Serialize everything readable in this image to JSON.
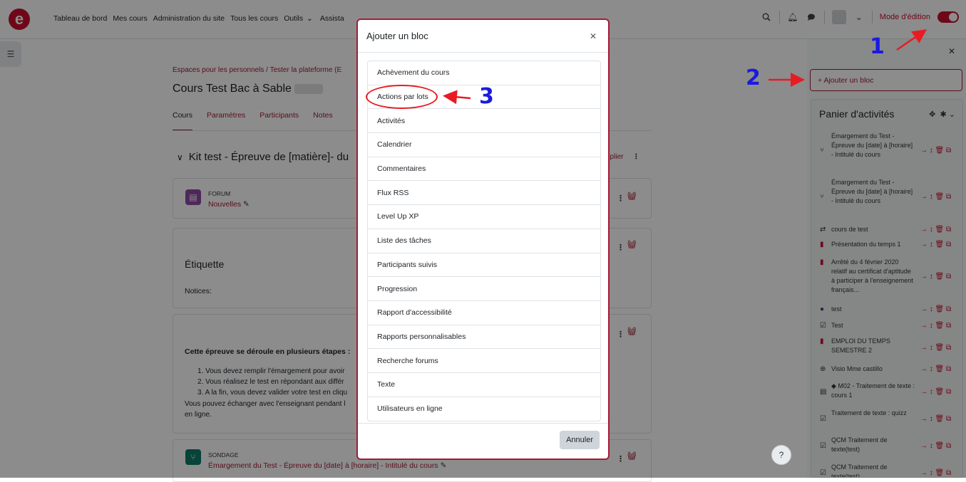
{
  "nav": {
    "logo": "e",
    "links": [
      "Tableau de bord",
      "Mes cours",
      "Administration du site",
      "Tous les cours",
      "Outils",
      "Assista"
    ],
    "mode_edition": "Mode d'édition"
  },
  "page": {
    "breadcrumb": "Espaces pour les personnels  /  Tester la plateforme (E",
    "title": "Cours Test Bac à Sable",
    "tabs": [
      "Cours",
      "Paramètres",
      "Participants",
      "Notes"
    ],
    "section_title": "Kit test - Épreuve de [matière]- du",
    "section_action": "eplier",
    "forum": {
      "type": "FORUM",
      "name": "Nouvelles"
    },
    "etiquette": {
      "title": "Étiquette",
      "notices": "Notices:"
    },
    "steps": {
      "heading": "Cette épreuve se déroule en plusieurs étapes :",
      "lines": [
        "1. Vous devez remplir l'émargement pour avoir",
        "2. Vous réalisez le test en répondant aux différ",
        "3. A la fin, vous devez valider votre test en cliqu"
      ],
      "footer": "Vous pouvez échanger avec l'enseignant pendant l",
      "footer2": "en ligne."
    },
    "sondage": {
      "type": "SONDAGE",
      "name": "Émargement du Test - Épreuve du [date] à [horaire] - Intitulé du cours"
    }
  },
  "modal": {
    "title": "Ajouter un bloc",
    "items": [
      "Achèvement du cours",
      "Actions par lots",
      "Activités",
      "Calendrier",
      "Commentaires",
      "Flux RSS",
      "Level Up XP",
      "Liste des tâches",
      "Participants suivis",
      "Progression",
      "Rapport d'accessibilité",
      "Rapports personnalisables",
      "Recherche forums",
      "Texte",
      "Utilisateurs en ligne"
    ],
    "cancel": "Annuler"
  },
  "drawer": {
    "add_block": "+   Ajouter un bloc",
    "panel_title": "Panier d'activités",
    "activities": [
      {
        "text": "Émargement du Test - Épreuve du [date] à [horaire] - Intitulé du cours",
        "icon": "poll-icon"
      },
      {
        "text": "Émargement du Test - Épreuve du [date] à [horaire] - Intitulé du cours",
        "icon": "poll-icon"
      },
      {
        "text": "cours de test",
        "icon": "lesson-icon"
      },
      {
        "text": "Présentation du temps 1",
        "icon": "pdf-icon"
      },
      {
        "text": "Arrêté du 4 février 2020 relatif au certificat d'aptitude à participer à l'enseignement français...",
        "icon": "pdf-icon"
      },
      {
        "text": "test",
        "icon": "bigbluebutton-icon"
      },
      {
        "text": "Test",
        "icon": "quiz-icon"
      },
      {
        "text": "EMPLOI DU TEMPS SEMESTRE 2",
        "icon": "pdf-icon"
      },
      {
        "text": "Visio Mme castillo",
        "icon": "globe-icon"
      },
      {
        "text": "◆ M02 - Traitement de texte : cours 1",
        "icon": "page-icon"
      },
      {
        "text": "Traitement de texte : quizz",
        "icon": "quiz-icon"
      },
      {
        "text": "QCM Traitement de texte(test)",
        "icon": "quiz-icon"
      },
      {
        "text": "QCM Traitement de texte(test)",
        "icon": "quiz-icon"
      }
    ]
  },
  "annotations": {
    "n1": "1",
    "n2": "2",
    "n3": "3"
  },
  "colors": {
    "accent": "#a41b35",
    "annotation_red": "#e81b23",
    "annotation_blue": "#1a1adf"
  }
}
